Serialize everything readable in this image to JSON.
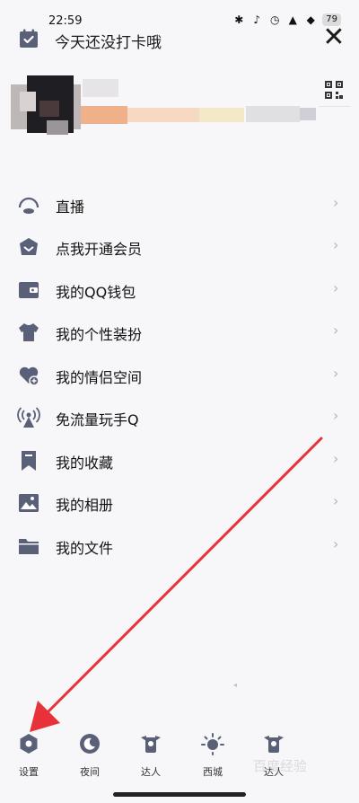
{
  "status_bar": {
    "time": "22:59",
    "battery": "79"
  },
  "header": {
    "checkin_text": "今天还没打卡哦",
    "close_glyph": "✕"
  },
  "profile": {
    "qr_icon": "qr-code-icon"
  },
  "menu": [
    {
      "label": "直播",
      "icon": "live-icon"
    },
    {
      "label": "点我开通会员",
      "icon": "vip-icon"
    },
    {
      "label": "我的QQ钱包",
      "icon": "wallet-icon"
    },
    {
      "label": "我的个性装扮",
      "icon": "shirt-icon"
    },
    {
      "label": "我的情侣空间",
      "icon": "heart-icon"
    },
    {
      "label": "免流量玩手Q",
      "icon": "signal-icon"
    },
    {
      "label": "我的收藏",
      "icon": "bookmark-icon"
    },
    {
      "label": "我的相册",
      "icon": "photo-icon"
    },
    {
      "label": "我的文件",
      "icon": "folder-icon"
    }
  ],
  "chevron": "›",
  "bottom_bar": [
    {
      "label": "设置",
      "icon": "settings-icon"
    },
    {
      "label": "夜间",
      "icon": "moon-icon"
    },
    {
      "label": "达人",
      "icon": "expert-icon"
    },
    {
      "label": "西城",
      "icon": "sun-icon"
    },
    {
      "label": "达人",
      "icon": "expert-icon"
    }
  ],
  "colors": {
    "icon": "#5b6079",
    "arrow": "#e8323a",
    "background": "#f7f7f9"
  }
}
